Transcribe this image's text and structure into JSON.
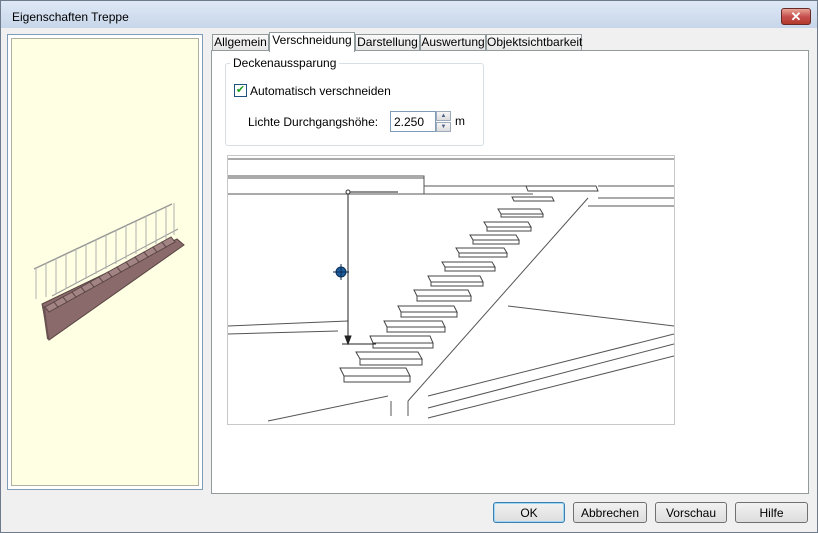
{
  "window": {
    "title": "Eigenschaften Treppe",
    "close_label": "✕"
  },
  "tabs": [
    {
      "label": "Allgemein"
    },
    {
      "label": "Verschneidung"
    },
    {
      "label": "Darstellung"
    },
    {
      "label": "Auswertung"
    },
    {
      "label": "Objektsichtbarkeit"
    }
  ],
  "active_tab": "Verschneidung",
  "deckenaussparung": {
    "group_label": "Deckenaussparung",
    "auto_label": "Automatisch verschneiden",
    "auto_checked": true,
    "check_glyph": "✔",
    "height_label": "Lichte Durchgangshöhe:",
    "height_value": "2.250",
    "height_unit": "m",
    "spin_up": "▲",
    "spin_down": "▼"
  },
  "buttons": {
    "ok": "OK",
    "cancel": "Abbrechen",
    "preview": "Vorschau",
    "help": "Hilfe"
  },
  "icons": {
    "close": "close-icon",
    "check": "checkmark-icon",
    "spin_up": "spin-up-icon",
    "spin_down": "spin-down-icon",
    "center_marker": "crosshair-icon"
  }
}
